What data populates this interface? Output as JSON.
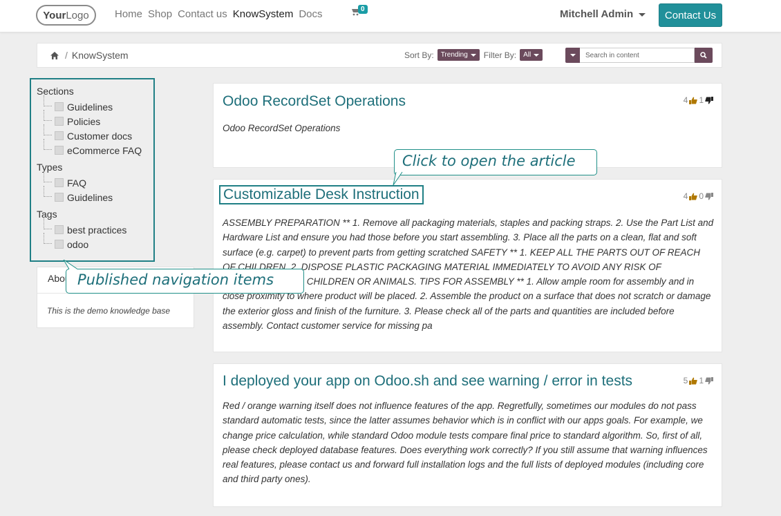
{
  "navbar": {
    "logo_text_bold": "Your",
    "logo_text": "Logo",
    "links": [
      "Home",
      "Shop",
      "Contact us",
      "KnowSystem",
      "Docs"
    ],
    "active_link": "KnowSystem",
    "cart_count": "0",
    "user_name": "Mitchell Admin",
    "contact_button": "Contact Us"
  },
  "breadcrumb": {
    "separator": "/",
    "current": "KnowSystem"
  },
  "toolbar": {
    "sort_label": "Sort By:",
    "sort_value": "Trending",
    "filter_label": "Filter By:",
    "filter_value": "All",
    "search_placeholder": "Search in content"
  },
  "sidebar": {
    "sections_title": "Sections",
    "sections": [
      "Guidelines",
      "Policies",
      "Customer docs",
      "eCommerce FAQ"
    ],
    "types_title": "Types",
    "types": [
      "FAQ",
      "Guidelines"
    ],
    "tags_title": "Tags",
    "tags": [
      "best practices",
      "odoo"
    ]
  },
  "about": {
    "title": "About",
    "text": "This is the demo knowledge base"
  },
  "articles": [
    {
      "title": "Odoo RecordSet Operations",
      "likes": "4",
      "dislikes": "1",
      "body": "Odoo RecordSet Operations"
    },
    {
      "title": "Customizable Desk Instruction",
      "likes": "4",
      "dislikes": "0",
      "body": "ASSEMBLY PREPARATION ** 1. Remove all packaging materials, staples and packing straps. 2. Use the Part List and Hardware List and ensure you had those before you start assembling. 3. Place all the parts on a clean, flat and soft surface (e.g. carpet) to prevent parts from getting scratched SAFETY ** 1. KEEP ALL THE PARTS OUT OF REACH OF CHILDREN. 2. DISPOSE PLASTIC PACKAGING MATERIAL IMMEDIATELY TO AVOID ANY RISK OF SUFFOCATION TO CHILDREN OR ANIMALS. TIPS FOR ASSEMBLY ** 1. Allow ample room for assembly and in close proximity to where product will be placed. 2. Assemble the product on a surface that does not scratch or damage the exterior gloss and finish of the furniture. 3. Please check all of the parts and quantities are included before assembly. Contact customer service for missing pa"
    },
    {
      "title": "I deployed your app on Odoo.sh and see warning / error in tests",
      "likes": "5",
      "dislikes": "1",
      "body": "Red / orange warning itself does not influence features of the app. Regretfully, sometimes our modules do not pass standard automatic tests, since the latter assumes behavior which is in conflict with our apps goals. For example, we change price calculation, while standard Odoo module tests compare final price to standard algorithm. So, first of all, please check deployed database features. Does everything work correctly? If you still assume that warning influences real features, please contact us and forward full installation logs and the full lists of deployed modules (including core and third party ones)."
    }
  ],
  "callouts": {
    "article": "Click to open the article",
    "navigation": "Published navigation items"
  },
  "colors": {
    "accent": "#21909a",
    "title": "#1e6f7a",
    "dropdown": "#6b4a5c",
    "highlight": "#1f7f85"
  }
}
